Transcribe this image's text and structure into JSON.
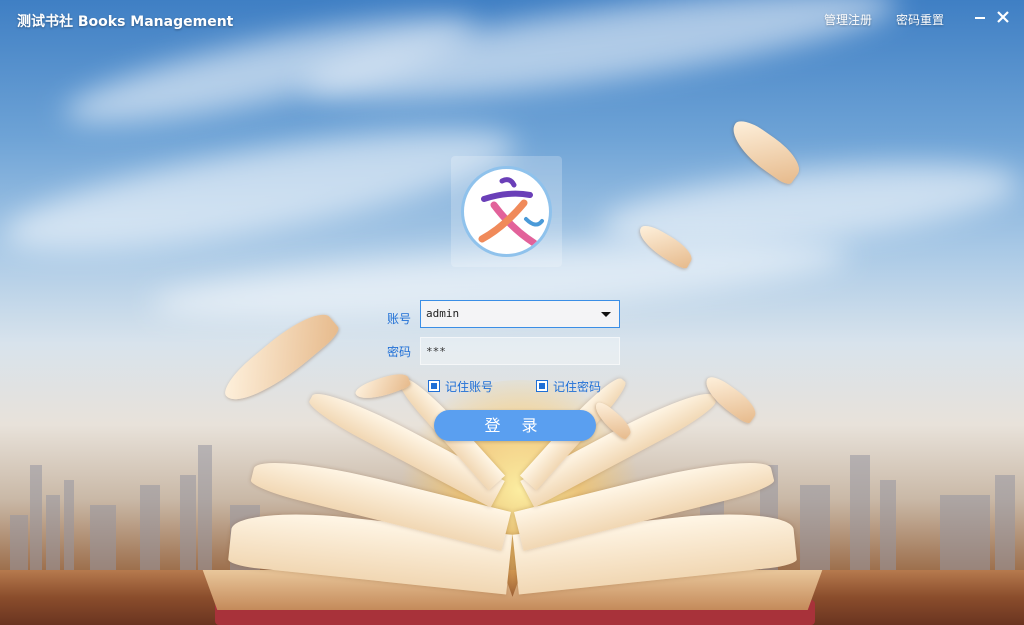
{
  "header": {
    "title": "测试书社 Books Management",
    "links": [
      "管理注册",
      "密码重置"
    ],
    "minimize_icon": "minimize-icon",
    "close_icon": "close-icon"
  },
  "logo": {
    "icon": "wen-character-logo",
    "colors": [
      "#6a3fb8",
      "#e2629a",
      "#f08a5a",
      "#4a9ad8"
    ]
  },
  "form": {
    "account_label": "账号",
    "account_value": "admin",
    "password_label": "密码",
    "password_value": "***",
    "remember_account": "记住账号",
    "remember_password": "记住密码",
    "login_button": "登 录"
  },
  "colors": {
    "accent": "#1f6fd6",
    "button": "#5a9ff0"
  }
}
